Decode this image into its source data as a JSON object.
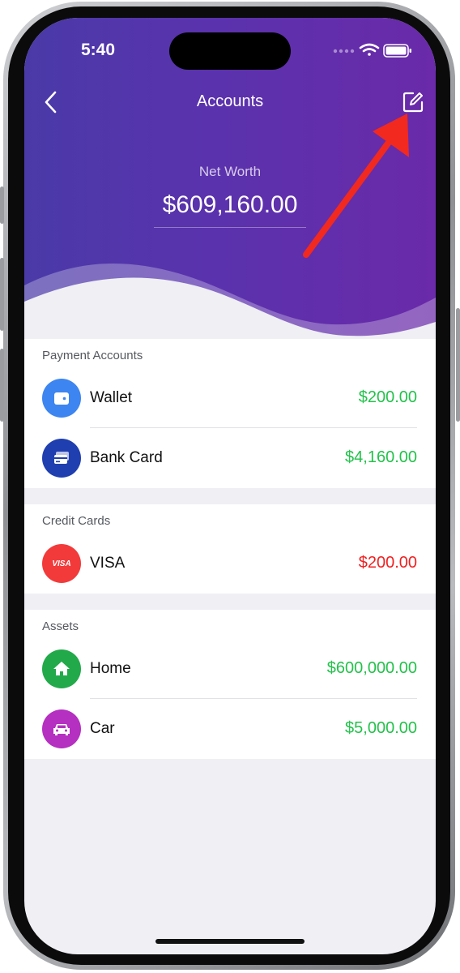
{
  "status_bar": {
    "time": "5:40"
  },
  "nav": {
    "title": "Accounts"
  },
  "summary": {
    "label": "Net Worth",
    "value": "$609,160.00"
  },
  "sections": {
    "payment": {
      "title": "Payment Accounts",
      "items": [
        {
          "label": "Wallet",
          "amount": "$200.00",
          "icon": "wallet-icon",
          "color": "#3d85f0",
          "amount_color": "#22c24a"
        },
        {
          "label": "Bank Card",
          "amount": "$4,160.00",
          "icon": "bank-card-icon",
          "color": "#1f3fb0",
          "amount_color": "#22c24a"
        }
      ]
    },
    "credit": {
      "title": "Credit Cards",
      "items": [
        {
          "label": "VISA",
          "amount": "$200.00",
          "icon": "visa-icon",
          "icon_text": "VISA",
          "color": "#f23a3a",
          "amount_color": "#f02020"
        }
      ]
    },
    "assets": {
      "title": "Assets",
      "items": [
        {
          "label": "Home",
          "amount": "$600,000.00",
          "icon": "home-icon",
          "color": "#22a94a",
          "amount_color": "#22c24a"
        },
        {
          "label": "Car",
          "amount": "$5,000.00",
          "icon": "car-icon",
          "color": "#b52fc1",
          "amount_color": "#22c24a"
        }
      ]
    }
  },
  "colors": {
    "header_start": "#4a3aa8",
    "header_end": "#6a2aa9",
    "positive": "#22c24a",
    "negative": "#f02020",
    "annotation_arrow": "#f2291e"
  }
}
